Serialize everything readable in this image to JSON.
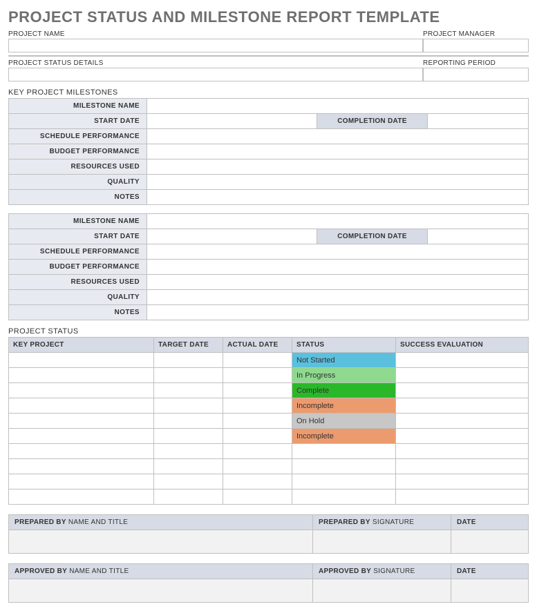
{
  "title": "PROJECT STATUS AND MILESTONE REPORT TEMPLATE",
  "fields": {
    "project_name_label": "PROJECT NAME",
    "project_name_value": "",
    "project_manager_label": "PROJECT MANAGER",
    "project_manager_value": "",
    "status_details_label": "PROJECT STATUS DETAILS",
    "status_details_value": "",
    "reporting_period_label": "REPORTING PERIOD",
    "reporting_period_value": ""
  },
  "milestones_header": "KEY PROJECT MILESTONES",
  "milestone_labels": {
    "name": "MILESTONE NAME",
    "start_date": "START DATE",
    "completion_date": "COMPLETION DATE",
    "schedule_performance": "SCHEDULE PERFORMANCE",
    "budget_performance": "BUDGET PERFORMANCE",
    "resources_used": "RESOURCES USED",
    "quality": "QUALITY",
    "notes": "NOTES"
  },
  "milestones": [
    {
      "name": "",
      "start_date": "",
      "completion_date": "",
      "schedule_performance": "",
      "budget_performance": "",
      "resources_used": "",
      "quality": "",
      "notes": ""
    },
    {
      "name": "",
      "start_date": "",
      "completion_date": "",
      "schedule_performance": "",
      "budget_performance": "",
      "resources_used": "",
      "quality": "",
      "notes": ""
    }
  ],
  "project_status_header": "PROJECT STATUS",
  "status_columns": {
    "key_project": "KEY PROJECT",
    "target_date": "TARGET DATE",
    "actual_date": "ACTUAL DATE",
    "status": "STATUS",
    "success_evaluation": "SUCCESS EVALUATION"
  },
  "status_rows": [
    {
      "key_project": "",
      "target_date": "",
      "actual_date": "",
      "status": "Not Started",
      "status_class": "status-not-started",
      "success_evaluation": ""
    },
    {
      "key_project": "",
      "target_date": "",
      "actual_date": "",
      "status": "In Progress",
      "status_class": "status-in-progress",
      "success_evaluation": ""
    },
    {
      "key_project": "",
      "target_date": "",
      "actual_date": "",
      "status": "Complete",
      "status_class": "status-complete",
      "success_evaluation": ""
    },
    {
      "key_project": "",
      "target_date": "",
      "actual_date": "",
      "status": "Incomplete",
      "status_class": "status-incomplete",
      "success_evaluation": ""
    },
    {
      "key_project": "",
      "target_date": "",
      "actual_date": "",
      "status": "On Hold",
      "status_class": "status-on-hold",
      "success_evaluation": ""
    },
    {
      "key_project": "",
      "target_date": "",
      "actual_date": "",
      "status": "Incomplete",
      "status_class": "status-incomplete",
      "success_evaluation": ""
    },
    {
      "key_project": "",
      "target_date": "",
      "actual_date": "",
      "status": "",
      "status_class": "",
      "success_evaluation": ""
    },
    {
      "key_project": "",
      "target_date": "",
      "actual_date": "",
      "status": "",
      "status_class": "",
      "success_evaluation": ""
    },
    {
      "key_project": "",
      "target_date": "",
      "actual_date": "",
      "status": "",
      "status_class": "",
      "success_evaluation": ""
    },
    {
      "key_project": "",
      "target_date": "",
      "actual_date": "",
      "status": "",
      "status_class": "",
      "success_evaluation": ""
    }
  ],
  "signoff": {
    "prepared_by_label": "PREPARED BY",
    "name_title_label": "NAME AND TITLE",
    "signature_label": "SIGNATURE",
    "date_label": "DATE",
    "approved_by_label": "APPROVED BY"
  }
}
